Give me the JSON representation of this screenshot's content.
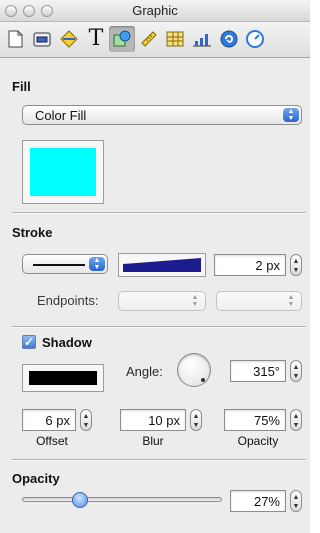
{
  "window": {
    "title": "Graphic"
  },
  "toolbar": {
    "tools": [
      {
        "icon": "document-icon",
        "selected": false
      },
      {
        "icon": "canvas-icon",
        "selected": false
      },
      {
        "icon": "diamond-icon",
        "selected": false
      },
      {
        "icon": "text-icon",
        "glyph": "T",
        "selected": false
      },
      {
        "icon": "graphic-icon",
        "selected": true
      },
      {
        "icon": "ruler-icon",
        "selected": false
      },
      {
        "icon": "table-icon",
        "selected": false
      },
      {
        "icon": "chart-icon",
        "selected": false
      },
      {
        "icon": "link-icon",
        "selected": false
      },
      {
        "icon": "metrics-icon",
        "selected": false
      }
    ]
  },
  "fill": {
    "title": "Fill",
    "type_value": "Color Fill",
    "color": "#00ffff"
  },
  "stroke": {
    "title": "Stroke",
    "width_value": "2 px",
    "color": "#1c1c8e",
    "endpoints_label": "Endpoints:"
  },
  "shadow": {
    "title": "Shadow",
    "checked": true,
    "color": "#000000",
    "angle_label": "Angle:",
    "angle_value": "315°",
    "offset_value": "6 px",
    "offset_label": "Offset",
    "blur_value": "10 px",
    "blur_label": "Blur",
    "opacity_value": "75%",
    "opacity_label": "Opacity"
  },
  "opacity": {
    "title": "Opacity",
    "value": "27%",
    "level": 0.27
  },
  "colors": {
    "accent": "#3f7bd4",
    "selection": "#b7b7b7"
  }
}
